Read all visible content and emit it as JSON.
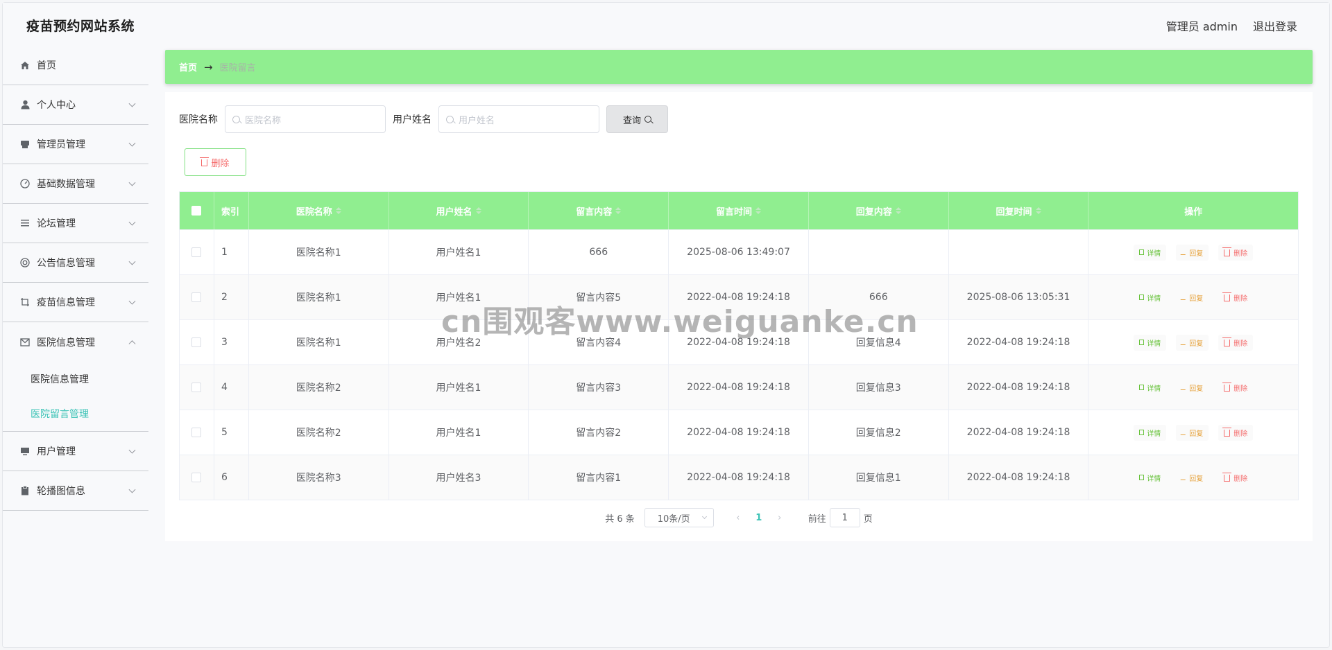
{
  "app": {
    "title": "疫苗预约网站系统"
  },
  "header": {
    "user_label": "管理员 admin",
    "logout_label": "退出登录"
  },
  "sidebar": {
    "items": [
      {
        "label": "首页",
        "icon": "home-icon",
        "expandable": false
      },
      {
        "label": "个人中心",
        "icon": "user-icon",
        "expandable": true
      },
      {
        "label": "管理员管理",
        "icon": "printer-icon",
        "expandable": true
      },
      {
        "label": "基础数据管理",
        "icon": "gauge-icon",
        "expandable": true
      },
      {
        "label": "论坛管理",
        "icon": "list-icon",
        "expandable": true
      },
      {
        "label": "公告信息管理",
        "icon": "lifebuoy-icon",
        "expandable": true
      },
      {
        "label": "疫苗信息管理",
        "icon": "crop-icon",
        "expandable": true
      },
      {
        "label": "医院信息管理",
        "icon": "mail-icon",
        "expandable": true,
        "open": true,
        "children": [
          {
            "label": "医院信息管理"
          },
          {
            "label": "医院留言管理",
            "active": true
          }
        ]
      },
      {
        "label": "用户管理",
        "icon": "monitor-icon",
        "expandable": true
      },
      {
        "label": "轮播图信息",
        "icon": "clipboard-icon",
        "expandable": true
      }
    ]
  },
  "breadcrumb": {
    "home": "首页",
    "arrow": "→",
    "current": "医院留言"
  },
  "search": {
    "hospital_label": "医院名称",
    "hospital_placeholder": "医院名称",
    "user_label": "用户姓名",
    "user_placeholder": "用户姓名",
    "button_label": "查询"
  },
  "toolbar": {
    "delete_label": "删除"
  },
  "table": {
    "columns": [
      "索引",
      "医院名称",
      "用户姓名",
      "留言内容",
      "留言时间",
      "回复内容",
      "回复时间",
      "操作"
    ],
    "op_labels": {
      "detail": "详情",
      "reply": "回复",
      "delete": "删除"
    },
    "rows": [
      {
        "index": "1",
        "hospital": "医院名称1",
        "user": "用户姓名1",
        "content": "666",
        "time": "2025-08-06 13:49:07",
        "reply": "",
        "reply_time": ""
      },
      {
        "index": "2",
        "hospital": "医院名称1",
        "user": "用户姓名1",
        "content": "留言内容5",
        "time": "2022-04-08 19:24:18",
        "reply": "666",
        "reply_time": "2025-08-06 13:05:31"
      },
      {
        "index": "3",
        "hospital": "医院名称1",
        "user": "用户姓名2",
        "content": "留言内容4",
        "time": "2022-04-08 19:24:18",
        "reply": "回复信息4",
        "reply_time": "2022-04-08 19:24:18"
      },
      {
        "index": "4",
        "hospital": "医院名称2",
        "user": "用户姓名1",
        "content": "留言内容3",
        "time": "2022-04-08 19:24:18",
        "reply": "回复信息3",
        "reply_time": "2022-04-08 19:24:18"
      },
      {
        "index": "5",
        "hospital": "医院名称2",
        "user": "用户姓名1",
        "content": "留言内容2",
        "time": "2022-04-08 19:24:18",
        "reply": "回复信息2",
        "reply_time": "2022-04-08 19:24:18"
      },
      {
        "index": "6",
        "hospital": "医院名称3",
        "user": "用户姓名3",
        "content": "留言内容1",
        "time": "2022-04-08 19:24:18",
        "reply": "回复信息1",
        "reply_time": "2022-04-08 19:24:18"
      }
    ]
  },
  "pagination": {
    "total_text": "共 6 条",
    "page_size": "10条/页",
    "current_page": "1",
    "goto_label": "前往",
    "goto_value": "1",
    "page_suffix": "页"
  },
  "watermark": "cn围观客www.weiguanke.cn",
  "colors": {
    "header_green": "#90ee90",
    "active_teal": "#3cc3b6",
    "danger": "#f56c6c",
    "warning": "#e6a23c",
    "success": "#67c23a"
  }
}
